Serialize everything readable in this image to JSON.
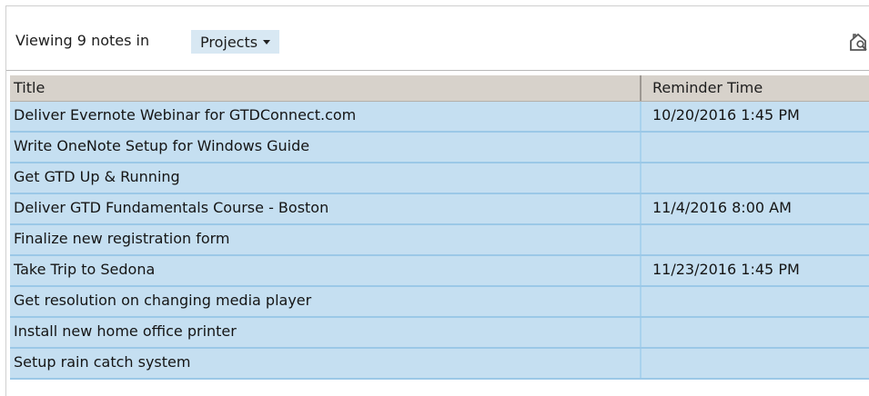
{
  "header": {
    "viewing_text": "Viewing 9 notes in",
    "scope_label": "Projects",
    "search_icon": "search-in-notebook-icon"
  },
  "table": {
    "columns": [
      "Title",
      "Reminder Time"
    ],
    "rows": [
      {
        "title": "Deliver Evernote Webinar for GTDConnect.com",
        "reminder": "10/20/2016 1:45 PM"
      },
      {
        "title": "Write OneNote Setup for Windows Guide",
        "reminder": ""
      },
      {
        "title": "Get GTD Up & Running",
        "reminder": ""
      },
      {
        "title": "Deliver GTD Fundamentals Course - Boston",
        "reminder": "11/4/2016 8:00 AM"
      },
      {
        "title": "Finalize new registration form",
        "reminder": ""
      },
      {
        "title": "Take Trip to Sedona",
        "reminder": "11/23/2016 1:45 PM"
      },
      {
        "title": "Get resolution on changing media player",
        "reminder": ""
      },
      {
        "title": "Install new home office printer",
        "reminder": ""
      },
      {
        "title": "Setup rain catch system",
        "reminder": ""
      }
    ]
  },
  "colors": {
    "row_fill": "#c5dff1",
    "row_border": "#9bc8e7",
    "header_fill": "#d7d2cb",
    "scope_fill": "#d8e8f3"
  }
}
